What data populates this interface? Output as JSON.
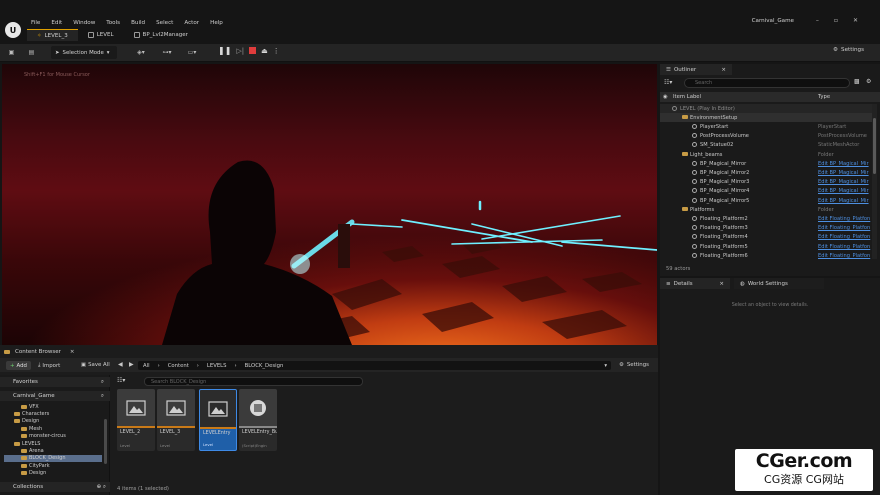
{
  "menu": [
    "File",
    "Edit",
    "Window",
    "Tools",
    "Build",
    "Select",
    "Actor",
    "Help"
  ],
  "window_title": "Carnival_Game",
  "tabs": [
    "LEVEL_3",
    "LEVEL",
    "BP_Lvl2Manager"
  ],
  "toolbar": {
    "selection_mode": "Selection Mode",
    "settings": "Settings"
  },
  "viewport": {
    "hint": "Shift+F1 for Mouse Cursor"
  },
  "outliner": {
    "title": "Outliner",
    "search_placeholder": "Search",
    "col_label": "Item Label",
    "col_type": "Type",
    "rows": [
      {
        "label": "LEVEL (Play In Editor)",
        "type": "",
        "indent": 0,
        "kind": "level"
      },
      {
        "label": "EnvironmentSetup",
        "type": "",
        "indent": 1,
        "kind": "folder"
      },
      {
        "label": "PlayerStart",
        "type": "PlayerStart",
        "indent": 2,
        "kind": "actor"
      },
      {
        "label": "PostProcessVolume",
        "type": "PostProcessVolume",
        "indent": 2,
        "kind": "actor"
      },
      {
        "label": "SM_Statue02",
        "type": "StaticMeshActor",
        "indent": 2,
        "kind": "actor"
      },
      {
        "label": "Light_beams",
        "type": "Folder",
        "indent": 1,
        "kind": "folder"
      },
      {
        "label": "BP_Magical_Mirror",
        "type": "Edit BP_Magical_Mir",
        "indent": 2,
        "kind": "link"
      },
      {
        "label": "BP_Magical_Mirror2",
        "type": "Edit BP_Magical_Mir",
        "indent": 2,
        "kind": "link"
      },
      {
        "label": "BP_Magical_Mirror3",
        "type": "Edit BP_Magical_Mir",
        "indent": 2,
        "kind": "link"
      },
      {
        "label": "BP_Magical_Mirror4",
        "type": "Edit BP_Magical_Mir",
        "indent": 2,
        "kind": "link"
      },
      {
        "label": "BP_Magical_Mirror5",
        "type": "Edit BP_Magical_Mir",
        "indent": 2,
        "kind": "link"
      },
      {
        "label": "Platforms",
        "type": "Folder",
        "indent": 1,
        "kind": "folder"
      },
      {
        "label": "Floating_Platform2",
        "type": "Edit Floating_Platfon",
        "indent": 2,
        "kind": "link"
      },
      {
        "label": "Floating_Platform3",
        "type": "Edit Floating_Platfon",
        "indent": 2,
        "kind": "link"
      },
      {
        "label": "Floating_Platform4",
        "type": "Edit Floating_Platfon",
        "indent": 2,
        "kind": "link"
      },
      {
        "label": "Floating_Platform5",
        "type": "Edit Floating_Platfon",
        "indent": 2,
        "kind": "link"
      },
      {
        "label": "Floating_Platform6",
        "type": "Edit Floating_Platfon",
        "indent": 2,
        "kind": "link"
      }
    ],
    "actor_count": "59 actors"
  },
  "details": {
    "tab1": "Details",
    "tab2": "World Settings",
    "message": "Select an object to view details."
  },
  "content_browser": {
    "title": "Content Browser",
    "add": "Add",
    "import": "Import",
    "save_all": "Save All",
    "breadcrumbs": [
      "All",
      "Content",
      "LEVELS",
      "BLOCK_Design"
    ],
    "settings": "Settings",
    "favorites": "Favorites",
    "project": "Carnival_Game",
    "collections": "Collections",
    "search_placeholder": "Search BLOCK_Design",
    "tree": [
      {
        "label": "VFX",
        "indent": 3
      },
      {
        "label": "Characters",
        "indent": 2
      },
      {
        "label": "Design",
        "indent": 2
      },
      {
        "label": "Mesh",
        "indent": 3
      },
      {
        "label": "monster-circus",
        "indent": 3
      },
      {
        "label": "LEVELS",
        "indent": 2
      },
      {
        "label": "Arena",
        "indent": 3
      },
      {
        "label": "BLOCK_Design",
        "indent": 3,
        "selected": true
      },
      {
        "label": "CityPark",
        "indent": 3
      },
      {
        "label": "Design",
        "indent": 3
      }
    ],
    "assets": [
      {
        "name": "LEVEL_2",
        "kind": "Level",
        "selected": false
      },
      {
        "name": "LEVEL_3",
        "kind": "Level",
        "selected": false
      },
      {
        "name": "LEVELEntry",
        "kind": "Level",
        "selected": true
      },
      {
        "name": "LEVELEntry_BuiltData",
        "kind": "(Script)Engin",
        "selected": false
      }
    ],
    "item_count": "4 items (1 selected)"
  },
  "watermark": {
    "line1": "CGer.com",
    "line2": "CG资源 CG网站"
  },
  "colors": {
    "accent": "#e0a000",
    "selection": "#1f5fa8",
    "link": "#4d8fe0",
    "beam": "#6ff0ff"
  }
}
